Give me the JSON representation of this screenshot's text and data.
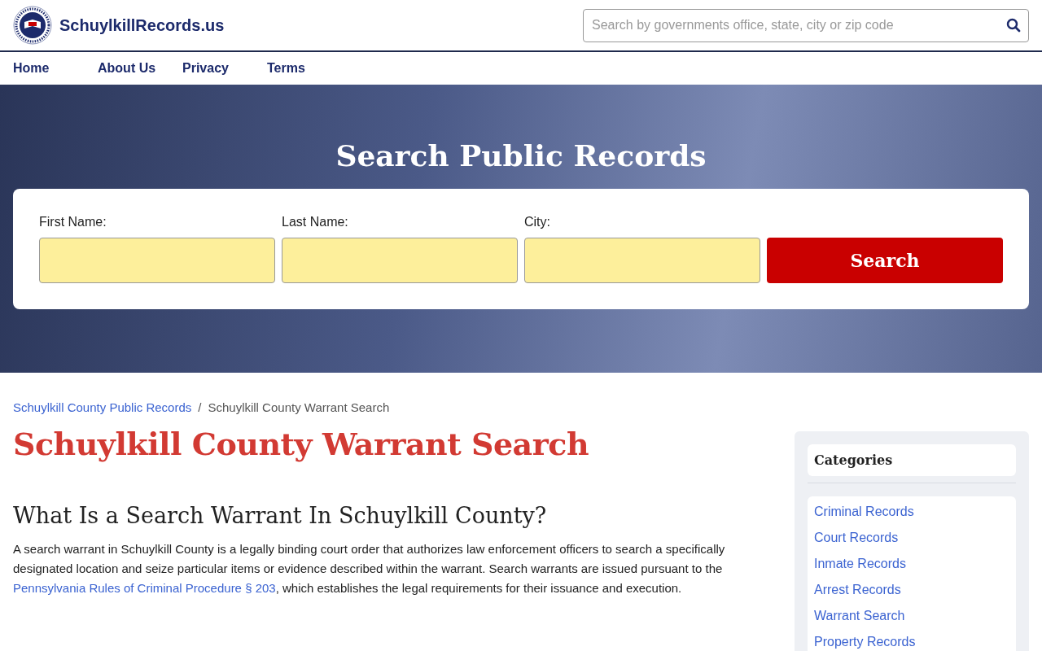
{
  "header": {
    "site_name": "SchuylkillRecords.us",
    "search": {
      "placeholder": "Search by governments office, state, city or zip code"
    }
  },
  "nav": [
    {
      "label": "Home"
    },
    {
      "label": "About Us"
    },
    {
      "label": "Privacy"
    },
    {
      "label": "Terms"
    }
  ],
  "hero": {
    "title": "Search Public Records",
    "fields": [
      {
        "label": "First Name:"
      },
      {
        "label": "Last Name:"
      },
      {
        "label": "City:"
      }
    ],
    "button": "Search"
  },
  "breadcrumb": [
    {
      "label": "Schuylkill County Public Records",
      "link": true
    },
    {
      "label": "Schuylkill County Warrant Search",
      "link": false
    }
  ],
  "breadcrumb_separator": "/",
  "article": {
    "title": "Schuylkill County Warrant Search",
    "heading": "What Is a Search Warrant In Schuylkill County?",
    "paragraph": [
      {
        "text": "A search warrant in Schuylkill County is a legally binding court order that authorizes law enforcement officers to search a specifically designated location and seize particular items or evidence described within the warrant. Search warrants are issued pursuant to the ",
        "link": false
      },
      {
        "text": "Pennsylvania Rules of Criminal Procedure § 203",
        "link": true
      },
      {
        "text": ", which establishes the legal requirements for their issuance and execution.",
        "link": false
      }
    ]
  },
  "sidebar": {
    "title": "Categories",
    "items": [
      "Criminal Records",
      "Court Records",
      "Inmate Records",
      "Arrest Records",
      "Warrant Search",
      "Property Records"
    ]
  }
}
